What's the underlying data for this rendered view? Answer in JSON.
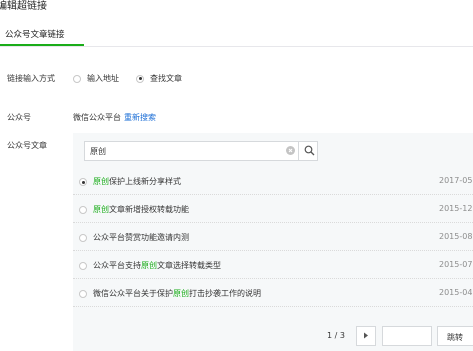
{
  "dialog": {
    "title": "编辑超链接"
  },
  "tabs": [
    {
      "label": "公众号文章链接",
      "active": true
    }
  ],
  "link_input": {
    "label": "链接输入方式",
    "options": [
      {
        "label": "输入地址",
        "checked": false
      },
      {
        "label": "查找文章",
        "checked": true
      }
    ]
  },
  "account": {
    "label": "公众号",
    "name": "微信公众平台",
    "research_link": "重新搜索"
  },
  "article": {
    "label": "公众号文章",
    "search_value": "原创",
    "results": [
      {
        "prefix": "",
        "highlight": "原创",
        "suffix": "保护上线新分享样式",
        "date": "2017-05",
        "selected": true
      },
      {
        "prefix": "",
        "highlight": "原创",
        "suffix": "文章新增授权转载功能",
        "date": "2015-12",
        "selected": false
      },
      {
        "prefix": "公众平台赞赏功能邀请内测",
        "highlight": "",
        "suffix": "",
        "date": "2015-08",
        "selected": false
      },
      {
        "prefix": "公众平台支持",
        "highlight": "原创",
        "suffix": "文章选择转载类型",
        "date": "2015-07",
        "selected": false
      },
      {
        "prefix": "微信公众平台关于保护",
        "highlight": "原创",
        "suffix": "打击抄袭工作的说明",
        "date": "2015-04",
        "selected": false
      }
    ]
  },
  "pagination": {
    "indicator": "1 / 3",
    "page_input": "",
    "jump_label": "跳转"
  },
  "colors": {
    "accent": "#1aad19",
    "link": "#1a6dd6"
  }
}
